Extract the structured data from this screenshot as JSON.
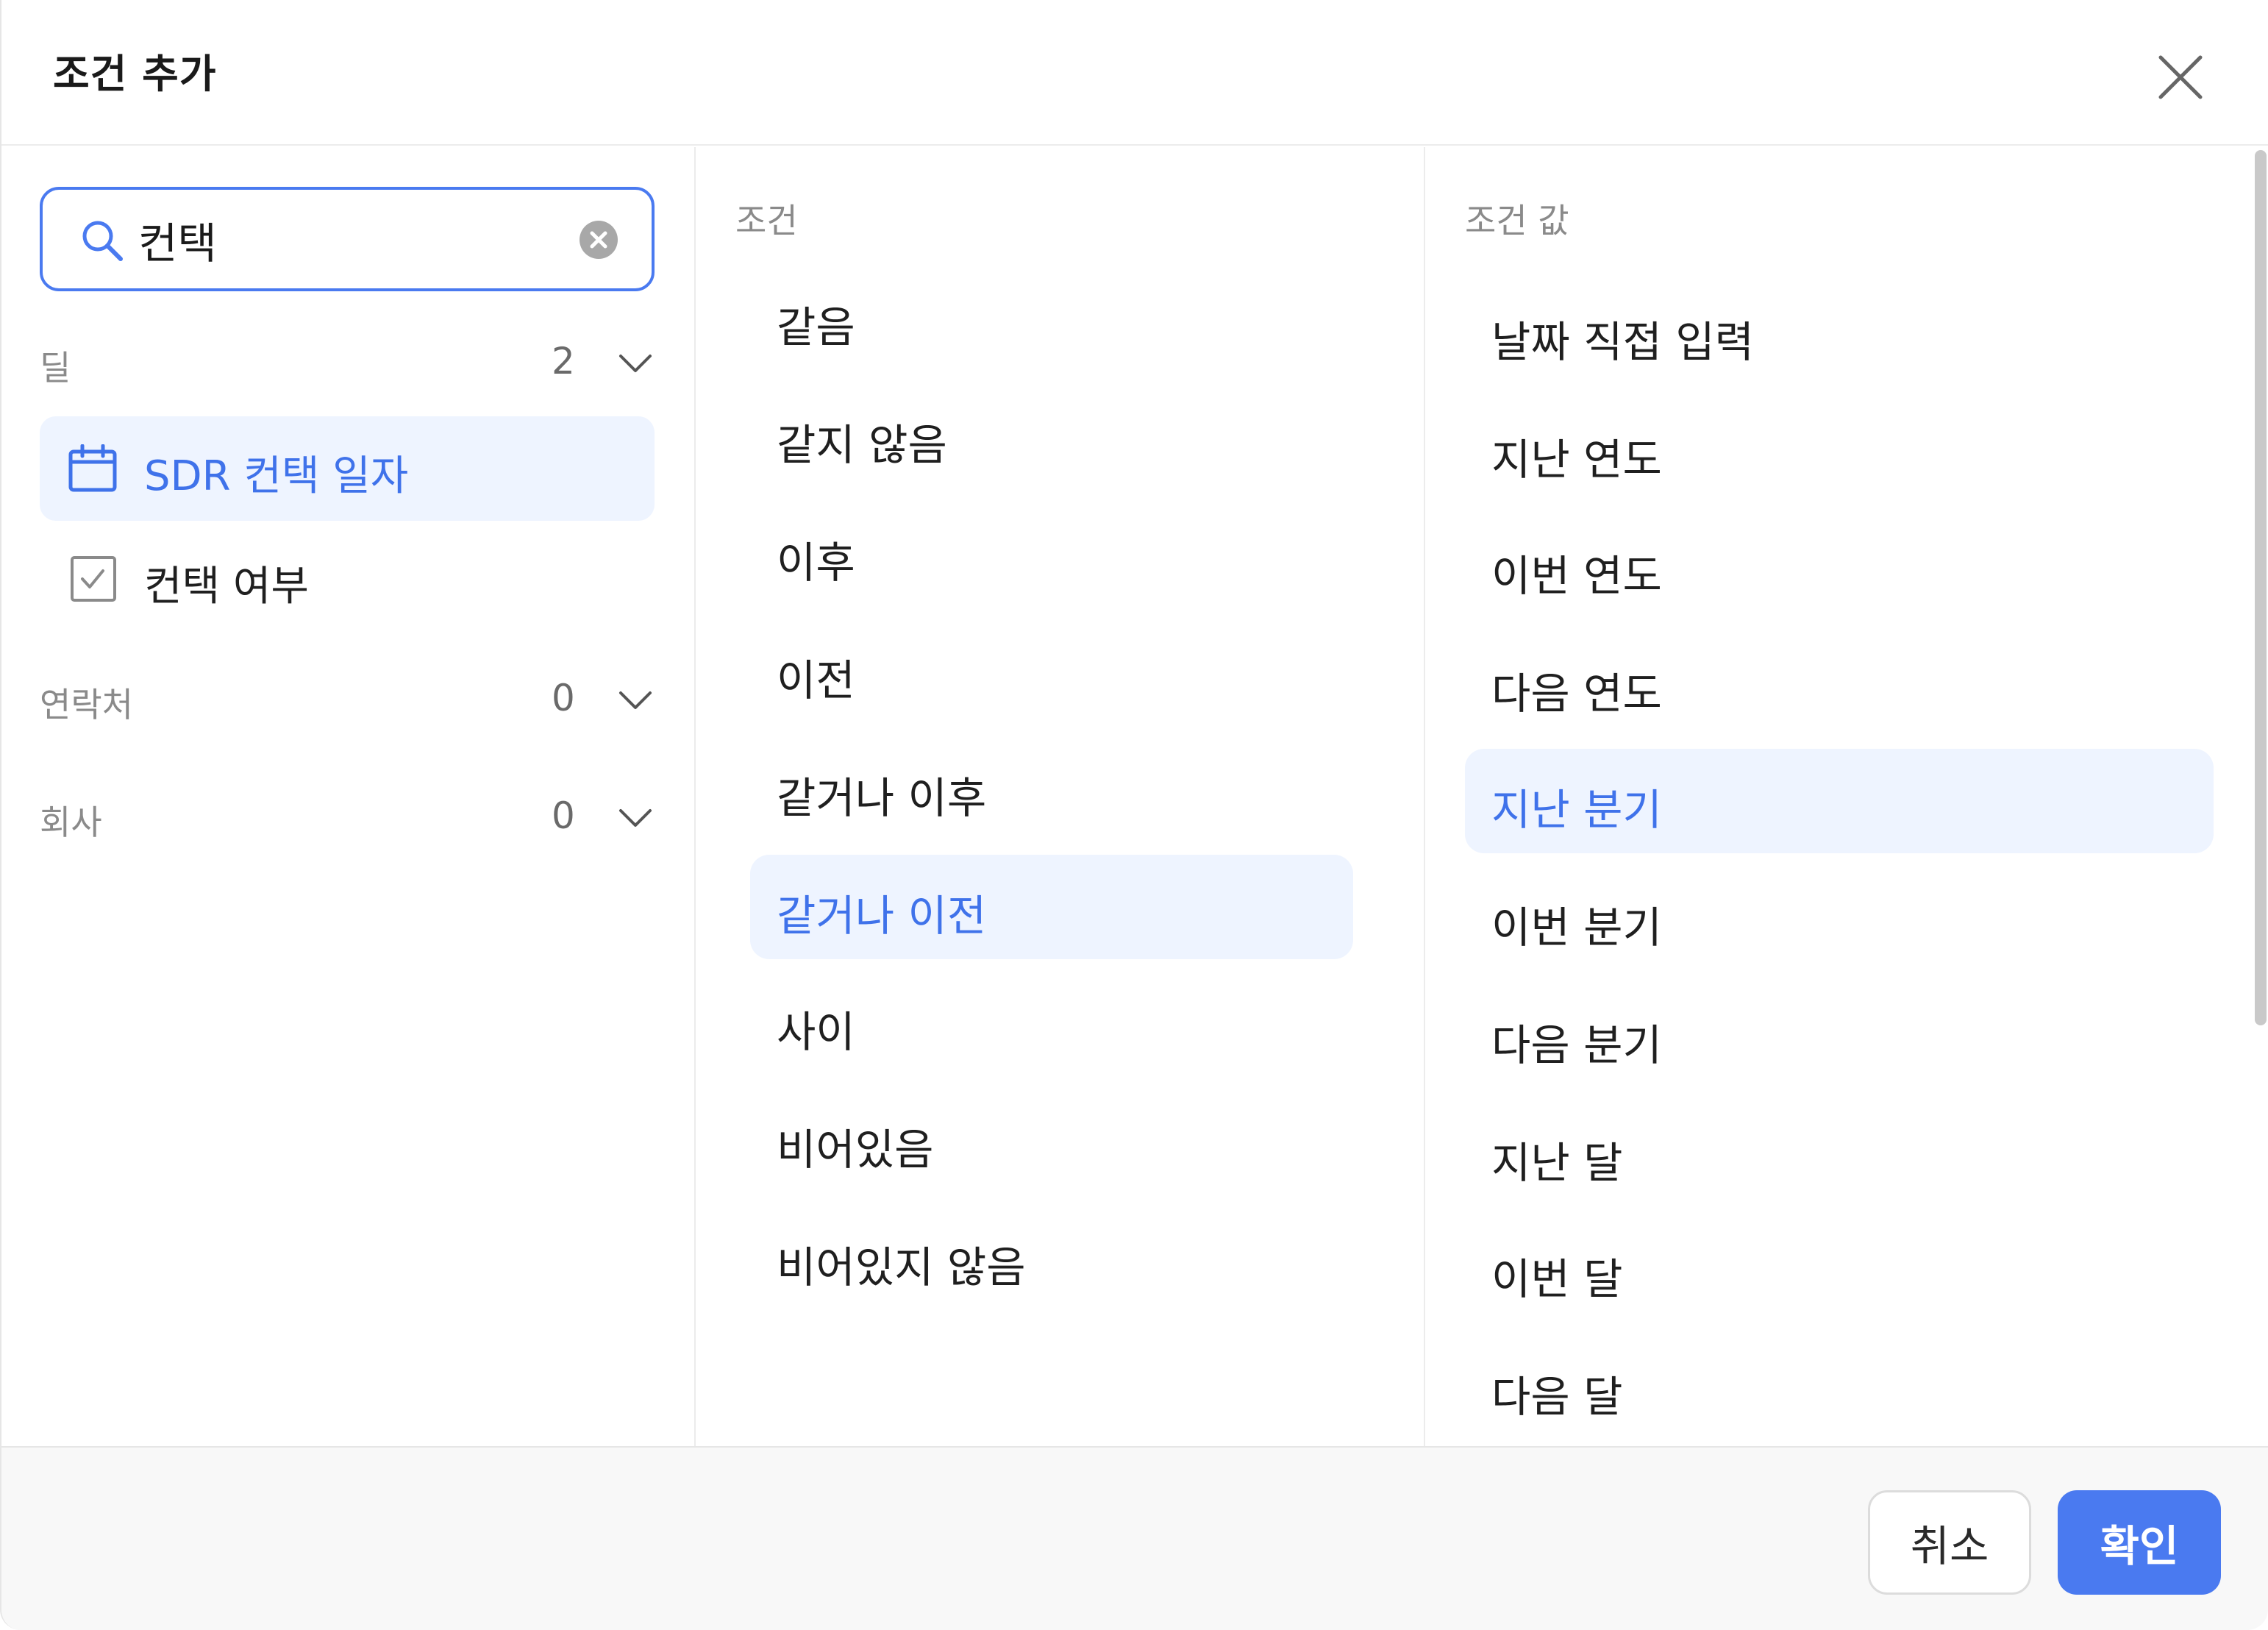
{
  "dialog": {
    "title": "조건 추가"
  },
  "search": {
    "value": "컨택",
    "placeholder": ""
  },
  "groups": [
    {
      "label": "딜",
      "count": "2",
      "expanded": true,
      "fields": [
        {
          "label": "SDR 컨택 일자",
          "icon": "calendar-icon",
          "selected": true
        },
        {
          "label": "컨택 여부",
          "icon": "checkbox-icon",
          "selected": false
        }
      ]
    },
    {
      "label": "연락처",
      "count": "0",
      "expanded": false,
      "fields": []
    },
    {
      "label": "회사",
      "count": "0",
      "expanded": false,
      "fields": []
    }
  ],
  "conditions": {
    "title": "조건",
    "items": [
      {
        "label": "같음",
        "selected": false
      },
      {
        "label": "같지 않음",
        "selected": false
      },
      {
        "label": "이후",
        "selected": false
      },
      {
        "label": "이전",
        "selected": false
      },
      {
        "label": "같거나 이후",
        "selected": false
      },
      {
        "label": "같거나 이전",
        "selected": true
      },
      {
        "label": "사이",
        "selected": false
      },
      {
        "label": "비어있음",
        "selected": false
      },
      {
        "label": "비어있지 않음",
        "selected": false
      }
    ]
  },
  "values": {
    "title": "조건 값",
    "items": [
      {
        "label": "날짜 직접 입력",
        "selected": false
      },
      {
        "label": "지난 연도",
        "selected": false
      },
      {
        "label": "이번 연도",
        "selected": false
      },
      {
        "label": "다음 연도",
        "selected": false
      },
      {
        "label": "지난 분기",
        "selected": true
      },
      {
        "label": "이번 분기",
        "selected": false
      },
      {
        "label": "다음 분기",
        "selected": false
      },
      {
        "label": "지난 달",
        "selected": false
      },
      {
        "label": "이번 달",
        "selected": false
      },
      {
        "label": "다음 달",
        "selected": false
      }
    ]
  },
  "footer": {
    "cancel_label": "취소",
    "confirm_label": "확인"
  },
  "colors": {
    "accent": "#4a7af0",
    "selected_bg": "#eef4ff",
    "selected_text": "#3f72ea",
    "muted_text": "#8a8a8a"
  }
}
